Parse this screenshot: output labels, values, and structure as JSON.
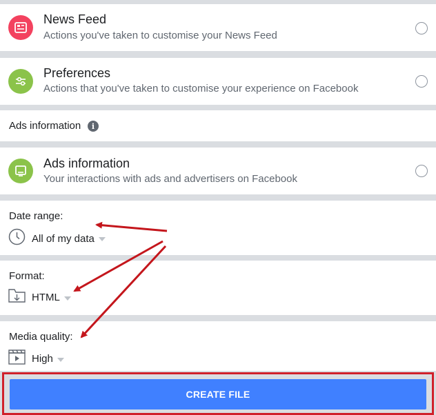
{
  "items": [
    {
      "title": "News Feed",
      "desc": "Actions you've taken to customise your News Feed",
      "icon": "news-feed-icon",
      "color": "#f3425f"
    },
    {
      "title": "Preferences",
      "desc": "Actions that you've taken to customise your experience on Facebook",
      "icon": "preferences-sliders-icon",
      "color": "#8bc34a"
    }
  ],
  "ads_section": {
    "label": "Ads information"
  },
  "ads_item": {
    "title": "Ads information",
    "desc": "Your interactions with ads and advertisers on Facebook",
    "icon": "ads-screen-icon",
    "color": "#8bc34a"
  },
  "date_range": {
    "label": "Date range:",
    "value": "All of my data",
    "icon": "clock-icon"
  },
  "format": {
    "label": "Format:",
    "value": "HTML",
    "icon": "download-folder-icon"
  },
  "media_quality": {
    "label": "Media quality:",
    "value": "High",
    "icon": "video-clapper-icon"
  },
  "create_button": {
    "label": "CREATE FILE",
    "color": "#4080ff"
  },
  "annotation_color": "#c4161c"
}
